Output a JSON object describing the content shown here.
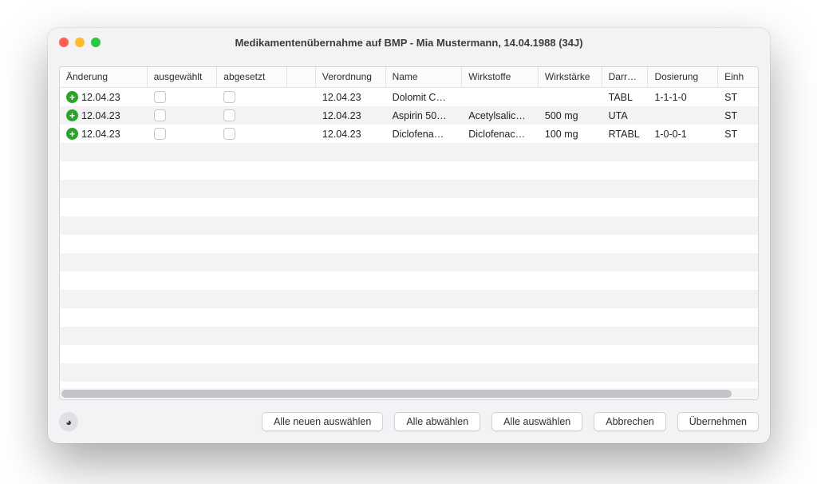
{
  "window": {
    "title": "Medikamentenübernahme auf BMP - Mia Mustermann, 14.04.1988 (34J)"
  },
  "table": {
    "headers": {
      "aenderung": "Änderung",
      "ausgewaehlt": "ausgewählt",
      "abgesetzt": "abgesetzt",
      "verordnung": "Verordnung",
      "name": "Name",
      "wirkstoffe": "Wirkstoffe",
      "wirkstaerke": "Wirkstärke",
      "darr": "Darrei…",
      "dosierung": "Dosierung",
      "einh": "Einh"
    },
    "rows": [
      {
        "aenderung": "12.04.23",
        "verordnung": "12.04.23",
        "name": "Dolomit C…",
        "wirkstoffe": "",
        "wirkstaerke": "",
        "darr": "TABL",
        "dosierung": "1-1-1-0",
        "einh": "ST"
      },
      {
        "aenderung": "12.04.23",
        "verordnung": "12.04.23",
        "name": "Aspirin 50…",
        "wirkstoffe": "Acetylsalic…",
        "wirkstaerke": "500 mg",
        "darr": "UTA",
        "dosierung": "",
        "einh": "ST"
      },
      {
        "aenderung": "12.04.23",
        "verordnung": "12.04.23",
        "name": "Diclofena…",
        "wirkstoffe": "Diclofenac…",
        "wirkstaerke": "100 mg",
        "darr": "RTABL",
        "dosierung": "1-0-0-1",
        "einh": "ST"
      }
    ]
  },
  "toolbar": {
    "select_all_new": "Alle neuen auswählen",
    "deselect_all": "Alle abwählen",
    "select_all": "Alle auswählen",
    "cancel": "Abbrechen",
    "apply": "Übernehmen"
  }
}
